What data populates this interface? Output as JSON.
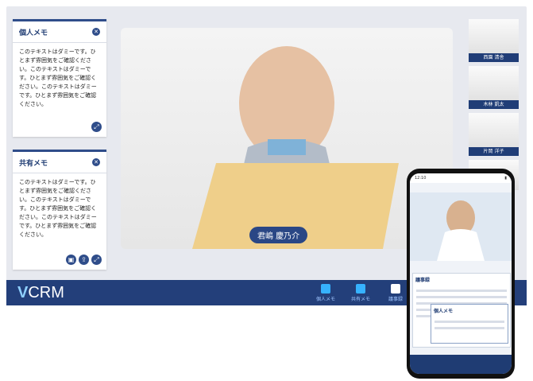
{
  "memo_personal": {
    "title": "個人メモ",
    "text": "このテキストはダミーです。ひとまず雰囲気をご確認ください。このテキストはダミーです。ひとまず雰囲気をご確認ください。このテキストはダミーです。ひとまず雰囲気をご確認ください。"
  },
  "memo_shared": {
    "title": "共有メモ",
    "text": "このテキストはダミーです。ひとまず雰囲気をご確認ください。このテキストはダミーです。ひとまず雰囲気をご確認ください。このテキストはダミーです。ひとまず雰囲気をご確認ください。"
  },
  "main_video": {
    "name": "君嶋 慶乃介"
  },
  "thumbnails": [
    {
      "name": "西園 清舎"
    },
    {
      "name": "木林 凱太"
    },
    {
      "name": "片岡 洋子"
    }
  ],
  "footer": {
    "logo_v": "V",
    "logo_text": "CRM",
    "buttons": [
      {
        "label": "個人メモ"
      },
      {
        "label": "共有メモ"
      },
      {
        "label": "議事録"
      }
    ]
  },
  "phone": {
    "status_time": "12:10",
    "section_title": "議事録",
    "memo_title": "個人メモ"
  }
}
